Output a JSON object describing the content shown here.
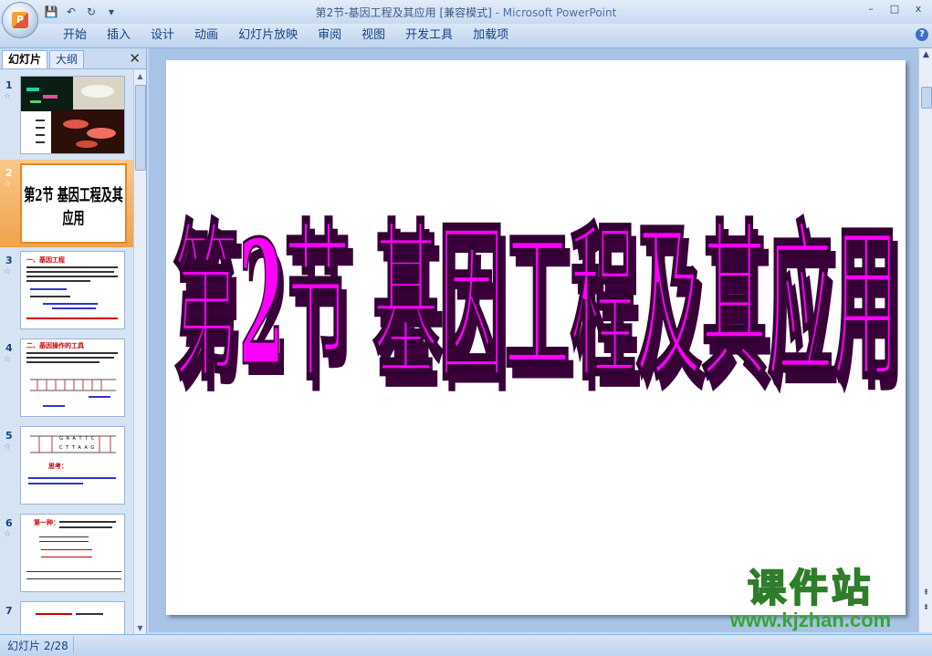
{
  "window": {
    "title": "第2节-基因工程及其应用 [兼容模式]",
    "app_name": "- Microsoft PowerPoint",
    "minimize": "–",
    "maximize": "□",
    "close": "x"
  },
  "quick_access": {
    "save_icon": "💾",
    "undo_icon": "↶",
    "redo_icon": "↻",
    "customize_icon": "▾"
  },
  "ribbon": {
    "tabs": [
      "开始",
      "插入",
      "设计",
      "动画",
      "幻灯片放映",
      "审阅",
      "视图",
      "开发工具",
      "加载项"
    ],
    "help": "?"
  },
  "panel": {
    "tab_slides": "幻灯片",
    "tab_outline": "大纲",
    "close": "✕",
    "thumbnails": [
      {
        "num": "1",
        "star": "☆"
      },
      {
        "num": "2",
        "star": "☆",
        "text": "第2节 基因工程及其应用"
      },
      {
        "num": "3",
        "star": "☆",
        "text": "一、基因工程"
      },
      {
        "num": "4",
        "star": "☆",
        "text": "二、基因操作的工具"
      },
      {
        "num": "5",
        "star": "☆",
        "text": "G A A T T C",
        "text2": "C T T A A G",
        "text3": "思考："
      },
      {
        "num": "6",
        "star": "☆",
        "text": "第一种："
      },
      {
        "num": "7",
        "star": "☆",
        "text": ""
      }
    ]
  },
  "slide": {
    "title": "第2节 基因工程及其应用"
  },
  "status": {
    "slide_counter": "幻灯片 2/28"
  },
  "watermark": {
    "line1": "课件站",
    "line2": "www.kjzhan.com"
  },
  "colors": {
    "title_fill": "#ff00ff",
    "watermark_yellow": "#ffe600",
    "watermark_green": "#35a632",
    "selection": "#f0a24a"
  }
}
